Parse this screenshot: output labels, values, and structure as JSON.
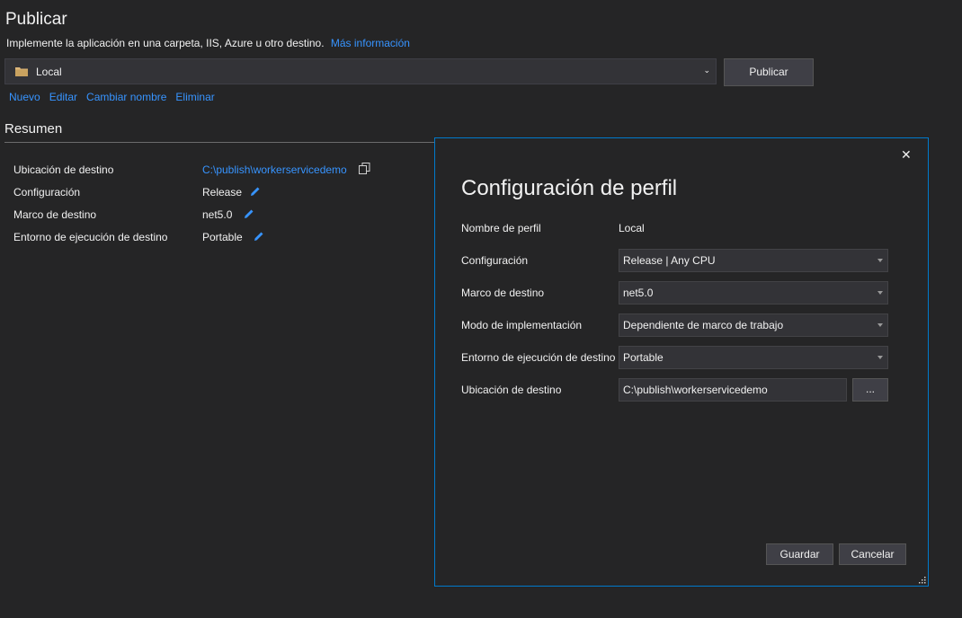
{
  "page": {
    "title": "Publicar",
    "subtitle": "Implemente la aplicación en una carpeta, IIS, Azure u otro destino.",
    "more_info_link": "Más información"
  },
  "profile_selector": {
    "value": "Local",
    "icon": "folder-icon",
    "arrow": "⌄"
  },
  "publish_button": "Publicar",
  "profile_actions": [
    "Nuevo",
    "Editar",
    "Cambiar nombre",
    "Eliminar"
  ],
  "summary": {
    "title": "Resumen",
    "rows": [
      {
        "label": "Ubicación de destino",
        "value": "C:\\publish\\workerservicedemo",
        "action_icon": "copy-icon"
      },
      {
        "label": "Configuración",
        "value": "Release",
        "action_icon": "pencil-icon"
      },
      {
        "label": "Marco de destino",
        "value": "net5.0",
        "action_icon": "pencil-icon"
      },
      {
        "label": "Entorno de ejecución de destino",
        "value": "Portable",
        "action_icon": "pencil-icon"
      }
    ]
  },
  "dialog": {
    "title": "Configuración de perfil",
    "close": "✕",
    "profile_name_label": "Nombre de perfil",
    "profile_name_value": "Local",
    "fields": [
      {
        "label": "Configuración",
        "value": "Release | Any CPU"
      },
      {
        "label": "Marco de destino",
        "value": "net5.0"
      },
      {
        "label": "Modo de implementación",
        "value": "Dependiente de marco de trabajo"
      },
      {
        "label": "Entorno de ejecución de destino",
        "value": "Portable"
      }
    ],
    "location_label": "Ubicación de destino",
    "location_value": "C:\\publish\\workerservicedemo",
    "browse_label": "...",
    "save_label": "Guardar",
    "cancel_label": "Cancelar"
  },
  "colors": {
    "background": "#252526",
    "accent": "#007acc",
    "link": "#3794ff",
    "folder": "#dcb67a"
  }
}
